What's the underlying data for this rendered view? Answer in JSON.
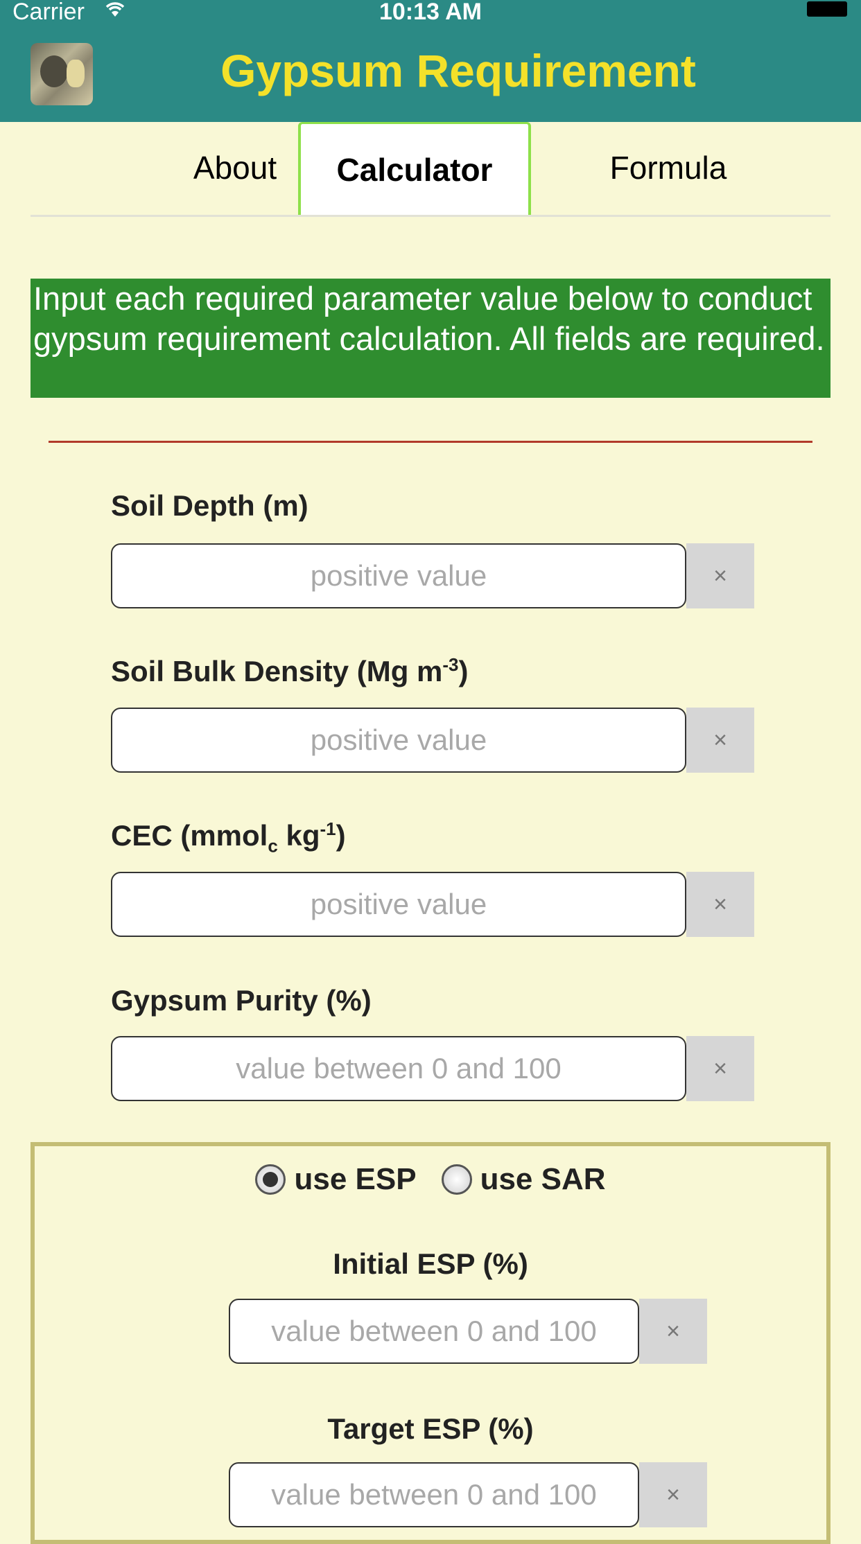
{
  "status_bar": {
    "carrier": "Carrier",
    "wifi_icon": "wifi-icon",
    "time": "10:13 AM",
    "battery_icon": "battery-icon"
  },
  "header": {
    "title": "Gypsum Requirement",
    "app_icon": "app-logo-icon"
  },
  "tabs": [
    {
      "label": "About",
      "selected": false
    },
    {
      "label": "Calculator",
      "selected": true
    },
    {
      "label": "Formula",
      "selected": false
    }
  ],
  "instructions": "Input each required parameter value below to conduct gypsum requirement calculation. All fields are required.",
  "fields": {
    "soil_depth": {
      "label": "Soil Depth (m)",
      "placeholder": "positive value",
      "value": ""
    },
    "bulk_density": {
      "label_main": "Soil Bulk Density (Mg m",
      "label_sup": "-3",
      "label_end": ")",
      "placeholder": "positive value",
      "value": ""
    },
    "cec": {
      "label_main": "CEC (mmol",
      "label_sub": "c",
      "label_mid": " kg",
      "label_sup": "-1",
      "label_end": ")",
      "placeholder": "positive value",
      "value": ""
    },
    "gypsum_purity": {
      "label": "Gypsum Purity (%)",
      "placeholder": "value between 0 and 100",
      "value": ""
    }
  },
  "clear_label": "×",
  "mode": {
    "options": [
      {
        "label": "use ESP",
        "checked": true
      },
      {
        "label": "use SAR",
        "checked": false
      }
    ]
  },
  "esp_fields": {
    "initial_esp": {
      "label": "Initial ESP (%)",
      "placeholder": "value between 0 and 100",
      "value": ""
    },
    "target_esp": {
      "label": "Target ESP (%)",
      "placeholder": "value between 0 and 100",
      "value": ""
    }
  },
  "colors": {
    "nav_background": "#2b8a85",
    "title": "#f4e12a",
    "page_background": "#f9f8d6",
    "banner": "#2f8d2f",
    "divider": "#b23a2a",
    "tab_accent": "#8ee04a",
    "panel_border": "#c4bd74"
  }
}
